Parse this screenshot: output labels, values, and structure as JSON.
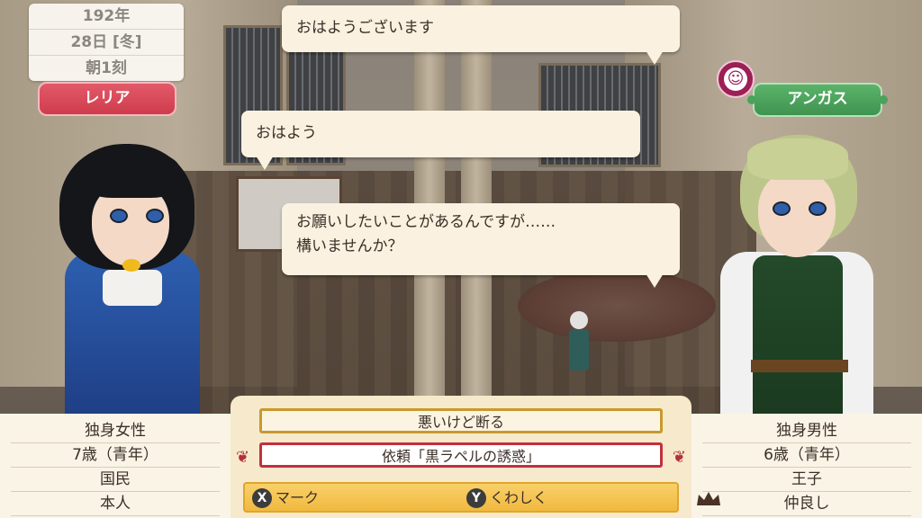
{
  "date": {
    "year": "192年",
    "day": "28日 [冬]",
    "time": "朝1刻"
  },
  "left_character": {
    "name": "レリア",
    "info": [
      "独身女性",
      "7歳（青年）",
      "国民",
      "本人"
    ]
  },
  "right_character": {
    "name": "アンガス",
    "mood_icon": "smile-icon",
    "info": [
      "独身男性",
      "6歳（青年）",
      "王子",
      "仲良し"
    ]
  },
  "dialogue": {
    "line1": "おはようございます",
    "line2": "おはよう",
    "line3a": "お願いしたいことがあるんですが……",
    "line3b": "構いませんか？"
  },
  "options": {
    "option1": "悪いけど断る",
    "option2": "依頼「黒ラペルの誘惑」"
  },
  "buttons": {
    "x_glyph": "X",
    "x_label": "マーク",
    "y_glyph": "Y",
    "y_label": "くわしく"
  },
  "colors": {
    "left_tag": "#cf3c4c",
    "right_tag": "#3f9450",
    "selected_border": "#c2303e",
    "option_border": "#c79a2c",
    "button_bar": "#f0b93f"
  }
}
